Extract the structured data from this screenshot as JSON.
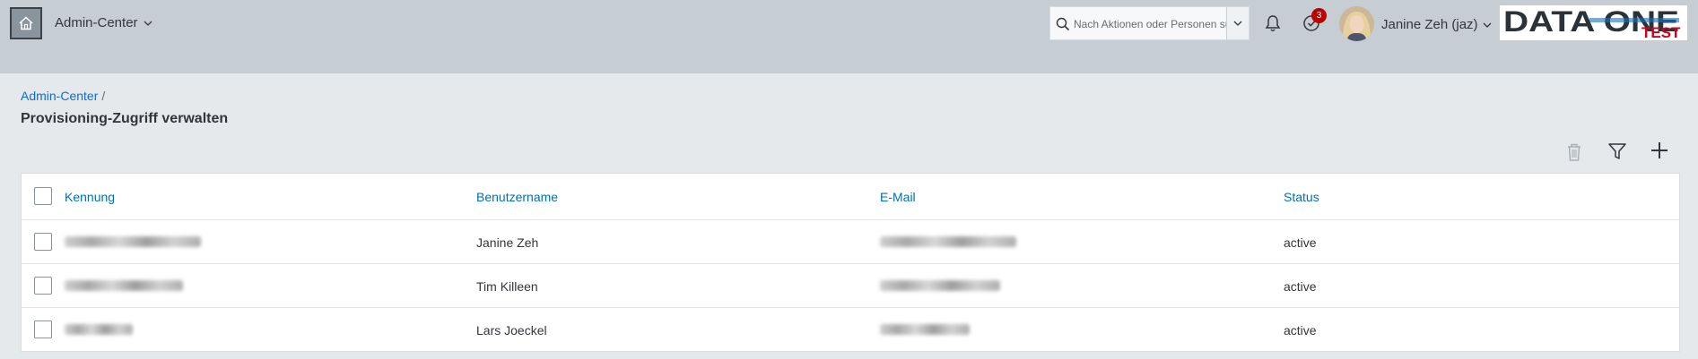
{
  "header": {
    "app_switch_label": "Admin-Center",
    "search_placeholder": "Nach Aktionen oder Personen suchen",
    "notification_count": "3",
    "user_name": "Janine Zeh (jaz)",
    "logo_text": "DATA ONE",
    "logo_sub": "TEST"
  },
  "breadcrumb": {
    "root": "Admin-Center",
    "separator": "/"
  },
  "page": {
    "title": "Provisioning-Zugriff verwalten"
  },
  "toolbar": {
    "icons": [
      "trash-icon",
      "filter-icon",
      "add-icon"
    ]
  },
  "table": {
    "columns": [
      "Kennung",
      "Benutzername",
      "E-Mail",
      "Status"
    ],
    "rows": [
      {
        "username": "Janine Zeh",
        "status": "active"
      },
      {
        "username": "Tim Killeen",
        "status": "active"
      },
      {
        "username": "Lars Joeckel",
        "status": "active"
      }
    ]
  },
  "colors": {
    "accent": "#0a6ed1",
    "header_bg": "#c7ced3",
    "page_bg": "#e5e9ec",
    "badge": "#bb0000"
  }
}
